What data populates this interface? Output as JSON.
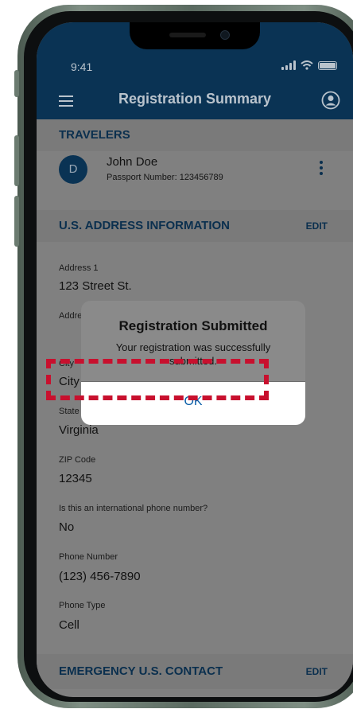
{
  "status": {
    "time": "9:41"
  },
  "header": {
    "title": "Registration Summary"
  },
  "travelers": {
    "section_title": "TRAVELERS",
    "items": [
      {
        "initial": "D",
        "name": "John Doe",
        "passport": "Passport Number: 123456789"
      }
    ]
  },
  "address": {
    "section_title": "U.S. ADDRESS INFORMATION",
    "edit_label": "EDIT",
    "fields": [
      {
        "label": "Address 1",
        "value": "123 Street St."
      },
      {
        "label": "Address 2",
        "value": ""
      },
      {
        "label": "City",
        "value": "City"
      },
      {
        "label": "State",
        "value": "Virginia"
      },
      {
        "label": "ZIP Code",
        "value": "12345"
      },
      {
        "label": "Is this an international phone number?",
        "value": "No"
      },
      {
        "label": "Phone Number",
        "value": "(123) 456-7890"
      },
      {
        "label": "Phone Type",
        "value": "Cell"
      }
    ]
  },
  "emergency": {
    "section_title": "EMERGENCY U.S. CONTACT",
    "edit_label": "EDIT"
  },
  "dialog": {
    "title": "Registration Submitted",
    "message": "Your registration was successfully submitted.",
    "ok_label": "OK"
  },
  "colors": {
    "header_bg": "#0a3354",
    "accent": "#0a5ea8",
    "highlight": "#c8102e"
  }
}
